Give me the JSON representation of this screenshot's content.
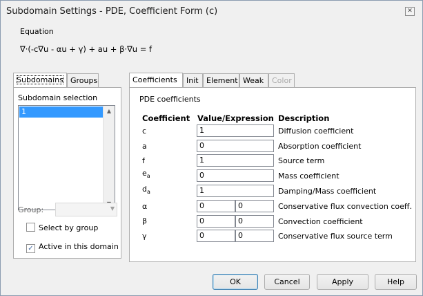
{
  "window": {
    "title": "Subdomain Settings - PDE, Coefficient Form (c)",
    "close_glyph": "✕"
  },
  "equation": {
    "legend": "Equation",
    "text": "∇·(-c∇u - αu + γ) + au + β·∇u = f"
  },
  "left_tabs": [
    {
      "label": "Subdomains",
      "active": true
    },
    {
      "label": "Groups",
      "active": false
    }
  ],
  "subdomain": {
    "legend": "Subdomain selection",
    "items": [
      "1"
    ],
    "selected": "1",
    "group_label": "Group:",
    "group_value": "",
    "select_by_group": {
      "label": "Select by group",
      "checked": false
    },
    "active_in_domain": {
      "label": "Active in this domain",
      "checked": true
    }
  },
  "right_tabs": [
    {
      "label": "Coefficients",
      "active": true,
      "disabled": false
    },
    {
      "label": "Init",
      "active": false,
      "disabled": false
    },
    {
      "label": "Element",
      "active": false,
      "disabled": false
    },
    {
      "label": "Weak",
      "active": false,
      "disabled": false
    },
    {
      "label": "Color",
      "active": false,
      "disabled": true
    }
  ],
  "pde": {
    "legend": "PDE coefficients",
    "headers": {
      "coefficient": "Coefficient",
      "value": "Value/Expression",
      "description": "Description"
    },
    "rows": [
      {
        "sym": "c",
        "sub": "",
        "values": [
          "1"
        ],
        "description": "Diffusion coefficient"
      },
      {
        "sym": "a",
        "sub": "",
        "values": [
          "0"
        ],
        "description": "Absorption coefficient"
      },
      {
        "sym": "f",
        "sub": "",
        "values": [
          "1"
        ],
        "description": "Source term"
      },
      {
        "sym": "e",
        "sub": "a",
        "values": [
          "0"
        ],
        "description": "Mass coefficient"
      },
      {
        "sym": "d",
        "sub": "a",
        "values": [
          "1"
        ],
        "description": "Damping/Mass coefficient"
      },
      {
        "sym": "α",
        "sub": "",
        "values": [
          "0",
          "0"
        ],
        "description": "Conservative flux convection coeff."
      },
      {
        "sym": "β",
        "sub": "",
        "values": [
          "0",
          "0"
        ],
        "description": "Convection coefficient"
      },
      {
        "sym": "γ",
        "sub": "",
        "values": [
          "0",
          "0"
        ],
        "description": "Conservative flux source term"
      }
    ]
  },
  "buttons": {
    "ok": "OK",
    "cancel": "Cancel",
    "apply": "Apply",
    "help": "Help"
  },
  "icons": {
    "scroll_up": "up-arrow-icon",
    "scroll_down": "down-arrow-icon",
    "dropdown": "chevron-down-icon",
    "check": "check-icon"
  }
}
